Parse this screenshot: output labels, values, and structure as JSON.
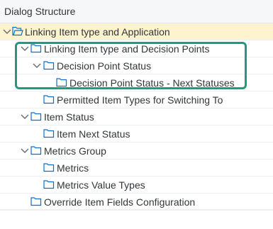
{
  "header": {
    "title": "Dialog Structure"
  },
  "tree": {
    "items": [
      {
        "label": "Linking Item type and Application",
        "expanded": true,
        "selected": true
      },
      {
        "label": "Linking Item type and Decision Points",
        "expanded": true
      },
      {
        "label": "Decision Point Status",
        "expanded": true
      },
      {
        "label": "Decision Point Status - Next Statuses"
      },
      {
        "label": "Permitted Item Types for Switching To"
      },
      {
        "label": "Item Status",
        "expanded": true
      },
      {
        "label": "Item Next Status"
      },
      {
        "label": "Metrics Group",
        "expanded": true
      },
      {
        "label": "Metrics"
      },
      {
        "label": "Metrics Value Types"
      },
      {
        "label": "Override Item Fields Configuration"
      }
    ]
  },
  "colors": {
    "highlight": "#239a7e",
    "selected_row": "#fdf3cf",
    "folder": "#0a6ed1"
  }
}
